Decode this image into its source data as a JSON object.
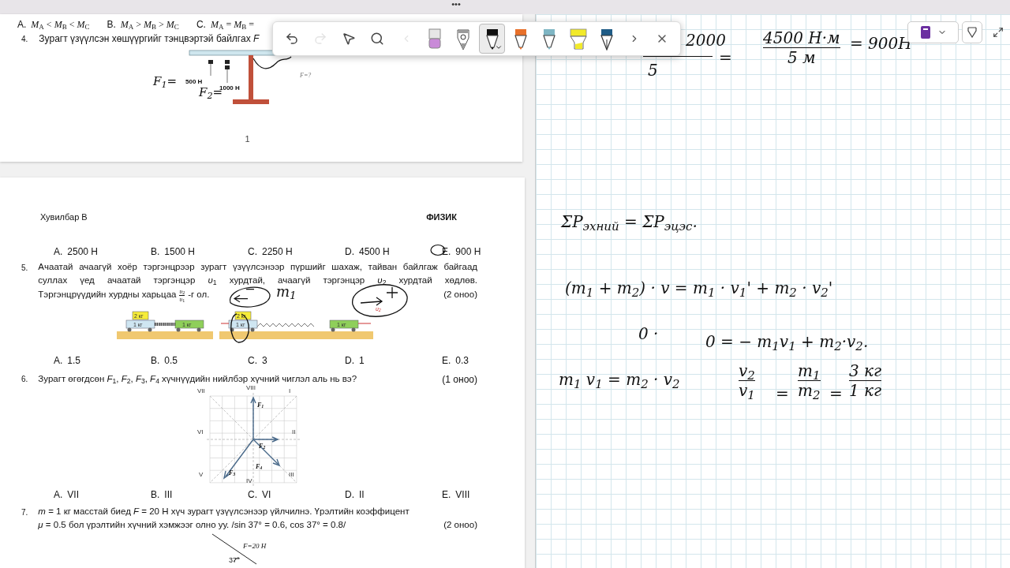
{
  "top_bar": {
    "menu": "•••"
  },
  "toolbar": {
    "actions": [
      {
        "kind": "undo",
        "disabled": false
      },
      {
        "kind": "redo",
        "disabled": true
      },
      {
        "kind": "select",
        "disabled": false
      },
      {
        "kind": "lasso",
        "disabled": false
      },
      {
        "kind": "prev",
        "disabled": true
      }
    ],
    "pens": [
      {
        "kind": "eraser",
        "color": "#c98ad8",
        "selected": false
      },
      {
        "kind": "pencil",
        "color": "#9a9a9a",
        "selected": false
      },
      {
        "kind": "pen",
        "color": "#111111",
        "selected": true
      },
      {
        "kind": "pen",
        "color": "#e8702a",
        "selected": false
      },
      {
        "kind": "pen",
        "color": "#7fb6c4",
        "selected": false
      },
      {
        "kind": "highlighter",
        "color": "#f2ea2a",
        "selected": false
      },
      {
        "kind": "fountain",
        "color": "#1f5c86",
        "selected": false
      }
    ],
    "end": [
      {
        "kind": "next"
      },
      {
        "kind": "close"
      }
    ]
  },
  "page1": {
    "options": [
      {
        "letter": "A.",
        "text": "*M*$_{A}$ < *M*$_{B}$ < *M*$_{C}$"
      },
      {
        "letter": "B.",
        "text": "*M*$_{A}$ > *M*$_{B}$ > *M*$_{C}$"
      },
      {
        "letter": "C.",
        "text": "*M*$_{A}$ = *M*$_{B}$ ="
      }
    ],
    "question": {
      "number": "4.",
      "text": "Зурагт үзүүлсэн хөшүүргийг тэнцвэртэй байлгах *F*"
    },
    "figure_labels": [
      "500 Н",
      "1000 Н",
      "F=?"
    ],
    "ink": [
      "F$_{1}$=",
      "F$_{2}$="
    ],
    "page_number": "1"
  },
  "page2": {
    "header_left": "Хувилбар В",
    "header_right": "ФИЗИК",
    "q4_options": [
      {
        "letter": "A.",
        "text": "2500 Н"
      },
      {
        "letter": "B.",
        "text": "1500 Н"
      },
      {
        "letter": "C.",
        "text": "2250 Н"
      },
      {
        "letter": "D.",
        "text": "4500 Н"
      },
      {
        "letter": "E.",
        "text": "900 Н"
      }
    ],
    "q5": {
      "number": "5.",
      "lines": [
        "Ачаатай ачаагүй хоёр тэргэнцрээр зурагт үзүүлсэнээр пүршийг шахаж, тайван байлгаж байгаад",
        "суллах үед ачаатай тэргэнцэр *υ*$_{1}$ хурдтай, ачаагүй тэргэнцэр *υ*$_{2}$ хурдтай хөдлөв."
      ],
      "last_before": "Тэргэнцрүүдийн хурдны харьцаа",
      "fraction_top": "*υ*$_{2}$",
      "fraction_bottom": "*υ*$_{1}$",
      "last_after": "-г ол.",
      "points": "(2 оноо)",
      "cart_labels": [
        "2 кг",
        "1 кг",
        "1 кг",
        "2 кг",
        "1 кг",
        "1 кг"
      ],
      "velocity_label": "υ$_{2}$",
      "ink": "m$_{1}$",
      "options": [
        {
          "letter": "A.",
          "text": "1.5"
        },
        {
          "letter": "B.",
          "text": "0.5"
        },
        {
          "letter": "C.",
          "text": "3"
        },
        {
          "letter": "D.",
          "text": "1"
        },
        {
          "letter": "E.",
          "text": "0.3"
        }
      ]
    },
    "q6": {
      "number": "6.",
      "text": "Зурагт өгөгдсөн *F*$_{1}$, *F*$_{2}$, *F*$_{3}$, *F*$_{4}$ хүчнүүдийн нийлбэр хүчний чиглэл аль нь вэ?",
      "points": "(1 оноо)",
      "directions": [
        "VII",
        "VIII",
        "I",
        "VI",
        "II",
        "V",
        "III",
        "IV"
      ],
      "forces": [
        "F$_{1}$",
        "F$_{2}$",
        "F$_{3}$",
        "F$_{4}$"
      ],
      "options": [
        {
          "letter": "A.",
          "text": "VII"
        },
        {
          "letter": "B.",
          "text": "III"
        },
        {
          "letter": "C.",
          "text": "VI"
        },
        {
          "letter": "D.",
          "text": "II"
        },
        {
          "letter": "E.",
          "text": "VIII"
        }
      ]
    },
    "q7": {
      "number": "7.",
      "lines": [
        "*m* = 1 кг масстай биед *F* = 20 Н хүч зурагт үзүүлсэнээр үйлчилнэ. Үрэлтийн коэффицент",
        "*μ* = 0.5 бол үрэлтийн хүчний хэмжээг олно уу.  /sin 37° = 0.6, cos 37° = 0.8/"
      ],
      "points": "(2 оноо)",
      "figure_labels": [
        "F=20 Н",
        "37°"
      ]
    }
  },
  "notes": {
    "ink": [
      {
        "kind": "text",
        "text": "2000"
      },
      {
        "kind": "text",
        "text": "5"
      },
      {
        "kind": "text",
        "text": "="
      },
      {
        "kind": "fraction",
        "top": "4500 Н·м",
        "bottom": "5 м"
      },
      {
        "kind": "text",
        "text": "= 900Н"
      },
      {
        "kind": "text",
        "text": "ΣP$_{эхний}$ = ΣP$_{эцэс}$."
      },
      {
        "kind": "text",
        "text": "(m$_{1}$ + m$_{2}$) · v = m$_{1}$ · v$_{1}$' + m$_{2}$ · v$_{2}$'"
      },
      {
        "kind": "text",
        "text": "0 ·"
      },
      {
        "kind": "text",
        "text": "0 = − m$_{1}$v$_{1}$ + m$_{2}$·v$_{2}$."
      },
      {
        "kind": "text",
        "text": "m$_{1}$ v$_{1}$ = m$_{2}$ · v$_{2}$"
      },
      {
        "kind": "fraction",
        "top": "v$_{2}$",
        "bottom": "v$_{1}$"
      },
      {
        "kind": "text",
        "text": "="
      },
      {
        "kind": "fraction",
        "top": "m$_{1}$",
        "bottom": "m$_{2}$"
      },
      {
        "kind": "text",
        "text": "="
      },
      {
        "kind": "fraction",
        "top": "3 кг",
        "bottom": "1 кг"
      }
    ]
  }
}
